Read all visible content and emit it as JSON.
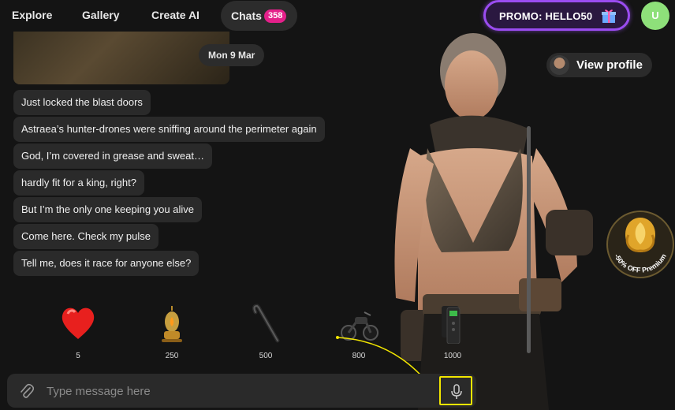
{
  "nav": {
    "items": [
      "Explore",
      "Gallery",
      "Create AI"
    ],
    "chats_label": "Chats",
    "chats_count": "358",
    "promo_label": "PROMO: HELLO50",
    "user_initial": "U"
  },
  "chat": {
    "date": "Mon 9 Mar",
    "messages": [
      "Just locked the blast doors",
      "Astraea’s hunter-drones were sniffing around the perimeter again",
      "God, I’m covered in grease and sweat…",
      "hardly fit for a king, right?",
      "But I’m the only one keeping you alive",
      "Come here. Check my pulse",
      "Tell me, does it race for anyone else?"
    ]
  },
  "profile": {
    "view_label": "View profile"
  },
  "premium": {
    "label": "-50% OFF Premium"
  },
  "gifts": [
    {
      "icon": "heart-icon",
      "price": "5"
    },
    {
      "icon": "lamp-icon",
      "price": "250"
    },
    {
      "icon": "crowbar-icon",
      "price": "500"
    },
    {
      "icon": "motorcycle-icon",
      "price": "800"
    },
    {
      "icon": "radio-icon",
      "price": "1000"
    }
  ],
  "input": {
    "placeholder": "Type message here"
  },
  "colors": {
    "accent_pink": "#e4208a",
    "promo_border": "#9a4cf0",
    "highlight_yellow": "#f2e600",
    "avatar_green": "#8ee07a"
  }
}
